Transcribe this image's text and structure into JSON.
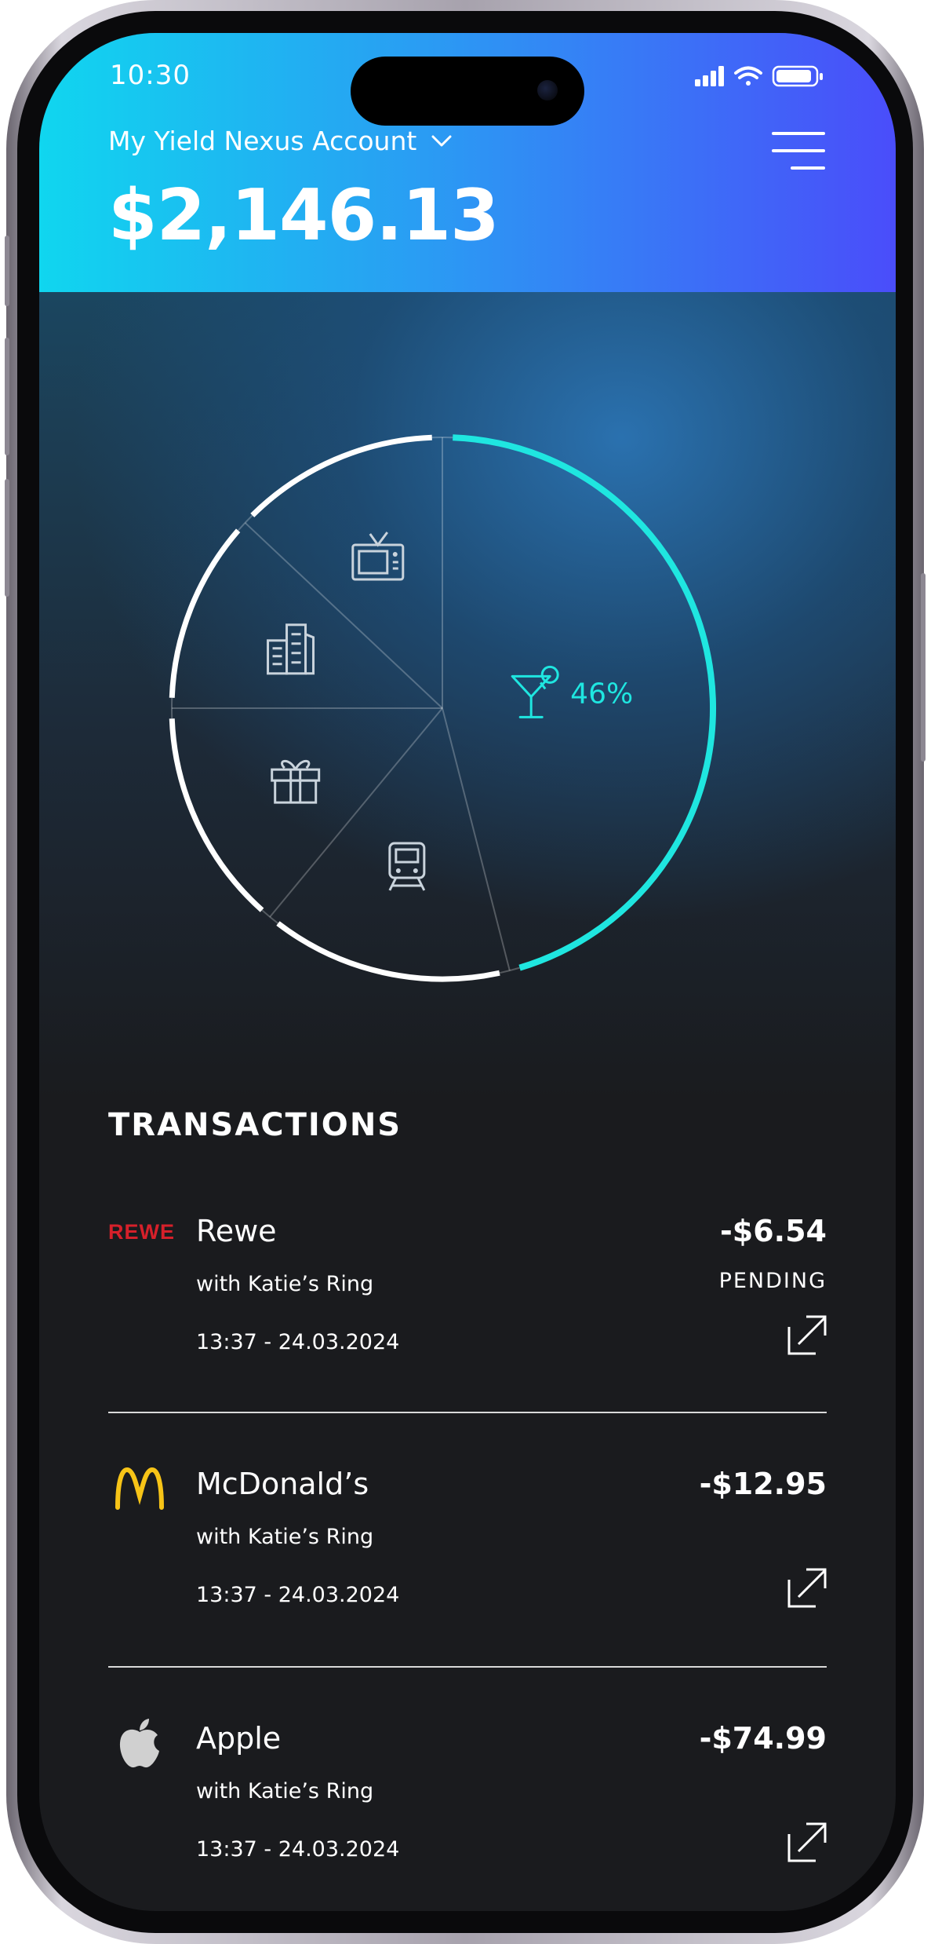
{
  "status_bar": {
    "time": "10:30"
  },
  "header": {
    "account_name": "My Yield Nexus Account",
    "balance": "$2,146.13"
  },
  "chart_data": {
    "type": "pie",
    "slices": [
      {
        "icon": "cocktail-icon",
        "value": 46,
        "label": "46%",
        "highlighted": true
      },
      {
        "icon": "train-icon",
        "value": 15
      },
      {
        "icon": "gift-icon",
        "value": 14
      },
      {
        "icon": "buildings-icon",
        "value": 12
      },
      {
        "icon": "tv-icon",
        "value": 13
      }
    ],
    "colors": {
      "highlight": "#1fe6e0",
      "default": "#ffffff"
    }
  },
  "transactions": {
    "title": "TRANSACTIONS",
    "items": [
      {
        "merchant": "Rewe",
        "logo_text": "REWE",
        "logo_icon": "rewe-logo",
        "subtitle": "with Katie’s Ring",
        "datetime": "13:37 - 24.03.2024",
        "amount": "-$6.54",
        "status": "PENDING"
      },
      {
        "merchant": "McDonald’s",
        "logo_icon": "mcdonalds-logo",
        "subtitle": "with Katie’s Ring",
        "datetime": "13:37 - 24.03.2024",
        "amount": "-$12.95",
        "status": ""
      },
      {
        "merchant": "Apple",
        "logo_icon": "apple-logo",
        "subtitle": "with Katie’s Ring",
        "datetime": "13:37 - 24.03.2024",
        "amount": "-$74.99",
        "status": ""
      }
    ]
  },
  "colors": {
    "header_start": "#10d6ef",
    "header_end": "#4a4dfa",
    "accent": "#1fe6e0",
    "rewe_red": "#d6202a",
    "mcdonalds_yellow": "#f7c417"
  }
}
